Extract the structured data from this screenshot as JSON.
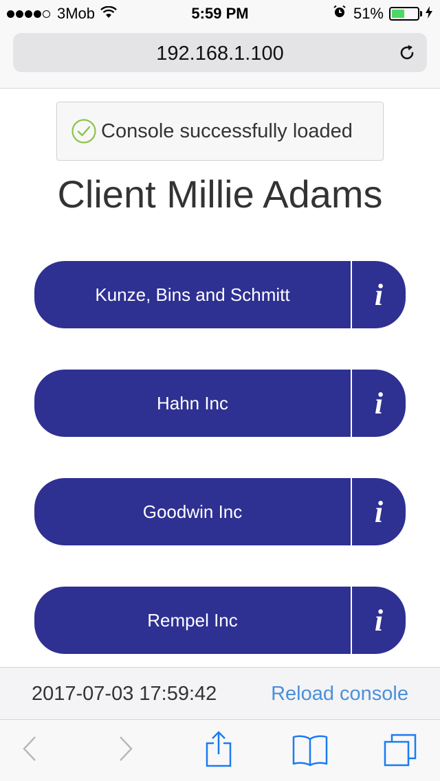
{
  "status_bar": {
    "carrier": "3Mob",
    "time": "5:59 PM",
    "battery_percent": "51%",
    "battery_level": 0.51,
    "signal_bars": 4,
    "signal_total": 5
  },
  "url_bar": {
    "url": "192.168.1.100",
    "reload_icon": "reload-icon"
  },
  "notice": {
    "text": "Console successfully loaded",
    "icon": "check-circle-icon",
    "icon_color": "#8bc34a"
  },
  "client": {
    "title": "Client Millie Adams"
  },
  "companies": [
    {
      "name": "Kunze, Bins and Schmitt",
      "info_label": "i"
    },
    {
      "name": "Hahn Inc",
      "info_label": "i"
    },
    {
      "name": "Goodwin Inc",
      "info_label": "i"
    },
    {
      "name": "Rempel Inc",
      "info_label": "i"
    }
  ],
  "footer": {
    "timestamp": "2017-07-03 17:59:42",
    "reload_label": "Reload console"
  },
  "toolbar": {
    "items": [
      "back-icon",
      "forward-icon",
      "share-icon",
      "bookmarks-icon",
      "tabs-icon"
    ]
  },
  "colors": {
    "button": "#2e3092",
    "link": "#4a90d9",
    "accent": "#1a7bf2"
  }
}
